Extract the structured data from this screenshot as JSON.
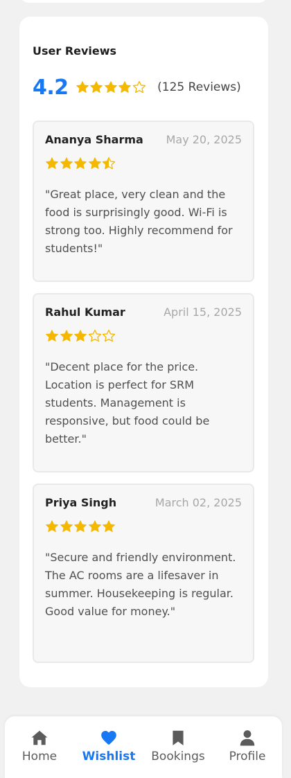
{
  "reviews_section": {
    "title": "User Reviews",
    "average_rating": "4.2",
    "average_rating_value": 4.2,
    "review_count_label": "(125 Reviews)"
  },
  "reviews": [
    {
      "name": "Ananya Sharma",
      "date": "May 20, 2025",
      "rating": 4.5,
      "text": "\"Great place, very clean and the food is surprisingly good. Wi-Fi is strong too. Highly recommend for students!\""
    },
    {
      "name": "Rahul Kumar",
      "date": "April 15, 2025",
      "rating": 3,
      "text": "\"Decent place for the price. Location is perfect for SRM students. Management is responsive, but food could be better.\""
    },
    {
      "name": "Priya Singh",
      "date": "March 02, 2025",
      "rating": 5,
      "text": "\"Secure and friendly environment. The AC rooms are a lifesaver in summer. Housekeeping is regular. Good value for money.\""
    }
  ],
  "bottom_nav": {
    "items": [
      {
        "label": "Home",
        "icon": "home-icon",
        "active": false
      },
      {
        "label": "Wishlist",
        "icon": "heart-icon",
        "active": true
      },
      {
        "label": "Bookings",
        "icon": "bookmark-icon",
        "active": false
      },
      {
        "label": "Profile",
        "icon": "user-icon",
        "active": false
      }
    ]
  },
  "colors": {
    "accent": "#1877f2",
    "star": "#f5b800",
    "inactive_nav": "#5b5b5b"
  }
}
